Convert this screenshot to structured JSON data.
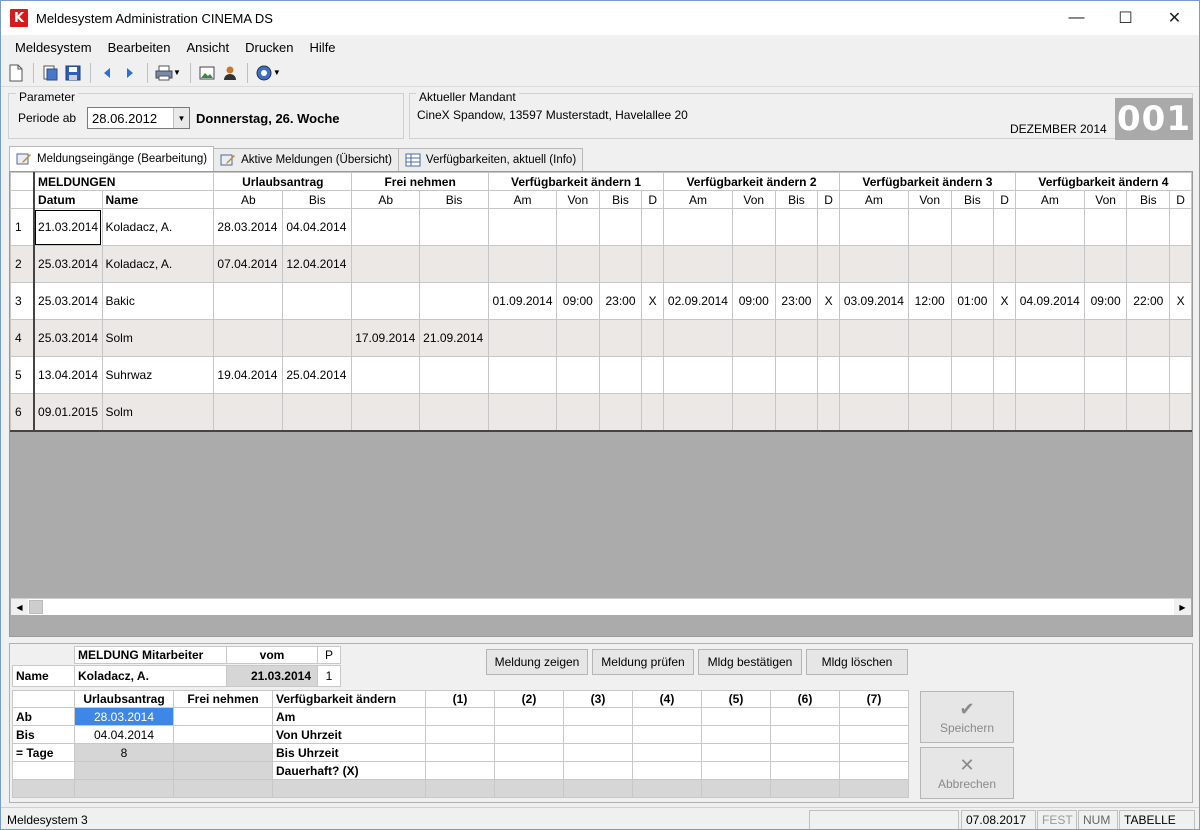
{
  "window": {
    "title": "Meldesystem Administration CINEMA DS",
    "logo_letter": "K",
    "min_glyph": "—",
    "max_glyph": "☐",
    "close_glyph": "✕"
  },
  "menu": [
    "Meldesystem",
    "Bearbeiten",
    "Ansicht",
    "Drucken",
    "Hilfe"
  ],
  "toolbar_icons": [
    "new-document-icon",
    "open-icon",
    "save-icon",
    "nav-back-icon",
    "nav-forward-icon",
    "print-icon",
    "image-icon",
    "user-icon",
    "help-icon"
  ],
  "parameter": {
    "legend": "Parameter",
    "periode_label": "Periode ab",
    "periode_value": "28.06.2012",
    "week_text": "Donnerstag, 26. Woche"
  },
  "mandant": {
    "legend": "Aktueller Mandant",
    "value": "CineX Spandow, 13597 Musterstadt, Havelallee 20",
    "month": "DEZEMBER 2014",
    "number": "001"
  },
  "tabs": [
    {
      "label": "Meldungseingänge (Bearbeitung)"
    },
    {
      "label": "Aktive Meldungen (Übersicht)"
    },
    {
      "label": "Verfügbarkeiten, aktuell (Info)"
    }
  ],
  "grid": {
    "group_headers": [
      "MELDUNGEN",
      "Urlaubsantrag",
      "Frei nehmen",
      "Verfügbarkeit ändern 1",
      "Verfügbarkeit ändern 2",
      "Verfügbarkeit ändern 3",
      "Verfügbarkeit ändern 4"
    ],
    "sub_headers": [
      "Datum",
      "Name",
      "Ab",
      "Bis",
      "Ab",
      "Bis",
      "Am",
      "Von",
      "Bis",
      "D",
      "Am",
      "Von",
      "Bis",
      "D",
      "Am",
      "Von",
      "Bis",
      "D",
      "Am",
      "Von",
      "Bis",
      "D"
    ],
    "rows": [
      [
        "1",
        "21.03.2014",
        "Koladacz, A.",
        "28.03.2014",
        "04.04.2014",
        "",
        "",
        "",
        "",
        "",
        "",
        "",
        "",
        "",
        "",
        "",
        "",
        "",
        "",
        "",
        "",
        "",
        ""
      ],
      [
        "2",
        "25.03.2014",
        "Koladacz, A.",
        "07.04.2014",
        "12.04.2014",
        "",
        "",
        "",
        "",
        "",
        "",
        "",
        "",
        "",
        "",
        "",
        "",
        "",
        "",
        "",
        "",
        "",
        ""
      ],
      [
        "3",
        "25.03.2014",
        "Bakic",
        "",
        "",
        "",
        "",
        "01.09.2014",
        "09:00",
        "23:00",
        "X",
        "02.09.2014",
        "09:00",
        "23:00",
        "X",
        "03.09.2014",
        "12:00",
        "01:00",
        "X",
        "04.09.2014",
        "09:00",
        "22:00",
        "X"
      ],
      [
        "4",
        "25.03.2014",
        "Solm",
        "",
        "",
        "17.09.2014",
        "21.09.2014",
        "",
        "",
        "",
        "",
        "",
        "",
        "",
        "",
        "",
        "",
        "",
        "",
        "",
        "",
        "",
        ""
      ],
      [
        "5",
        "13.04.2014",
        "Suhrwaz",
        "19.04.2014",
        "25.04.2014",
        "",
        "",
        "",
        "",
        "",
        "",
        "",
        "",
        "",
        "",
        "",
        "",
        "",
        "",
        "",
        "",
        "",
        ""
      ],
      [
        "6",
        "09.01.2015",
        "Solm",
        "",
        "",
        "",
        "",
        "",
        "",
        "",
        "",
        "",
        "",
        "",
        "",
        "",
        "",
        "",
        "",
        "",
        "",
        "",
        ""
      ]
    ]
  },
  "detail": {
    "header_meldung": "MELDUNG Mitarbeiter",
    "header_vom": "vom",
    "header_p": "P",
    "name_label": "Name",
    "name_value": "Koladacz, A.",
    "vom_value": "21.03.2014",
    "p_value": "1",
    "col_urlaub": "Urlaubsantrag",
    "col_frei": "Frei nehmen",
    "col_verf": "Verfügbarkeit ändern",
    "cols_num": [
      "(1)",
      "(2)",
      "(3)",
      "(4)",
      "(5)",
      "(6)",
      "(7)"
    ],
    "row_labels": [
      "Ab",
      "Bis",
      "= Tage"
    ],
    "urlaub_ab": "28.03.2014",
    "urlaub_bis": "04.04.2014",
    "tage": "8",
    "verf_rows": [
      "Am",
      "Von Uhrzeit",
      "Bis Uhrzeit",
      "Dauerhaft? (X)"
    ]
  },
  "actions": {
    "zeigen": "Meldung zeigen",
    "pruefen": "Meldung prüfen",
    "bestaetigen": "Mldg bestätigen",
    "loeschen": "Mldg löschen",
    "speichern": "Speichern",
    "abbrechen": "Abbrechen",
    "speichern_glyph": "✔",
    "abbrechen_glyph": "✕"
  },
  "status": {
    "left": "Meldesystem 3",
    "date": "07.08.2017",
    "fest": "FEST",
    "num": "NUM",
    "tabelle": "TABELLE"
  }
}
